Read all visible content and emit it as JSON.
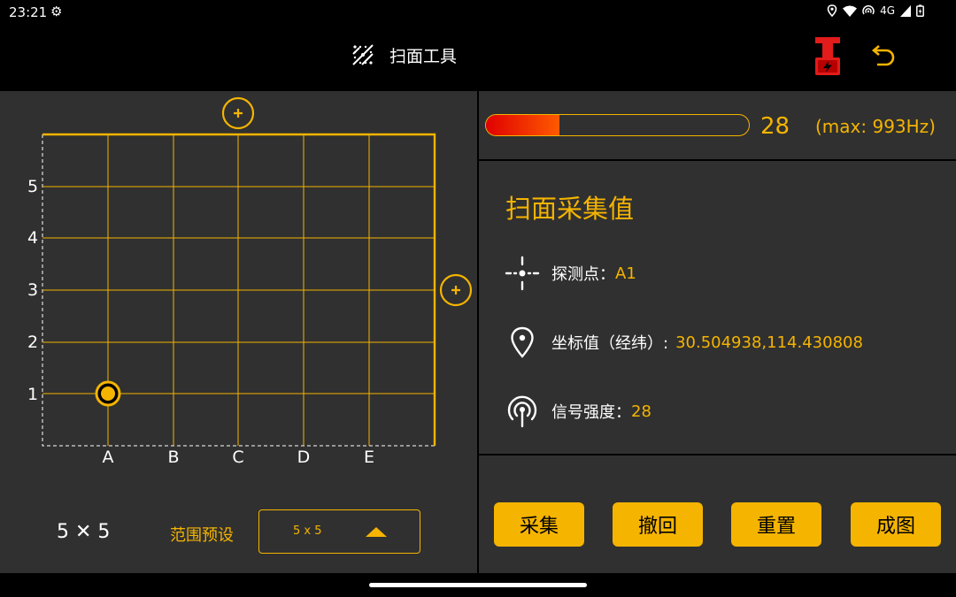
{
  "status": {
    "time": "23:21",
    "gear_icon": "gear-icon",
    "network": "4G"
  },
  "header": {
    "title": "扫面工具",
    "title_icon": "scan-grid-icon",
    "alert_icon": "device-battery-alert-icon",
    "back_icon": "return-arrow-icon"
  },
  "grid": {
    "columns": [
      "A",
      "B",
      "C",
      "D",
      "E"
    ],
    "rows": [
      "1",
      "2",
      "3",
      "4",
      "5"
    ],
    "selected_point": "A1",
    "add_column_icon": "plus-circle-icon",
    "add_row_icon": "plus-circle-icon"
  },
  "footer_left": {
    "size_label": "5 ✕ 5",
    "preset_label": "范围预设",
    "preset_value": "5 x 5"
  },
  "signal": {
    "value": "28",
    "max_text": "(max: 993Hz)",
    "fill_fraction": 0.28
  },
  "info": {
    "title": "扫面采集值",
    "point_label": "探测点：",
    "point_value": "A1",
    "coord_label": "坐标值（经纬）:",
    "coord_value": "30.504938,114.430808",
    "strength_label": "信号强度：",
    "strength_value": "28"
  },
  "actions": {
    "collect": "采集",
    "undo": "撤回",
    "reset": "重置",
    "map": "成图"
  },
  "colors": {
    "accent": "#f5b400",
    "panel": "#303030",
    "signal_fill": "#e00000"
  }
}
